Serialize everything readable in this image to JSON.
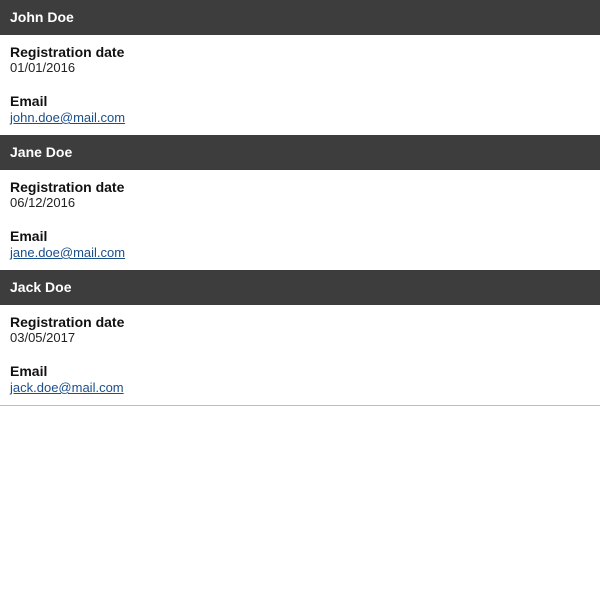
{
  "users": [
    {
      "name": "John Doe",
      "registration_label": "Registration date",
      "registration_date": "01/01/2016",
      "email_label": "Email",
      "email": "john.doe@mail.com"
    },
    {
      "name": "Jane Doe",
      "registration_label": "Registration date",
      "registration_date": "06/12/2016",
      "email_label": "Email",
      "email": "jane.doe@mail.com"
    },
    {
      "name": "Jack Doe",
      "registration_label": "Registration date",
      "registration_date": "03/05/2017",
      "email_label": "Email",
      "email": "jack.doe@mail.com"
    }
  ],
  "colors": {
    "header_bg": "#3d3d3d",
    "header_text": "#ffffff",
    "link": "#1a4f8c"
  }
}
